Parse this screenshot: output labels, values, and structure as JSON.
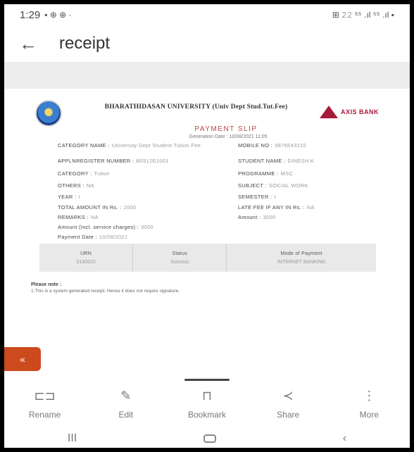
{
  "status_bar": {
    "time": "1:29",
    "indicators": "▪ ⊕ ⊕ ·",
    "system": "⊞ 𝟸𝟸 ⁵⁵ .ıl ⁵⁵ .ıl ▪"
  },
  "app_bar": {
    "title": "receipt"
  },
  "receipt": {
    "university": "BHARATHIDASAN UNIVERSITY (Univ Dept Stud.Tut.Fee)",
    "bank": "AXIS BANK",
    "slip_title": "PAYMENT SLIP",
    "generated": "Generation Date : 10/08/2021 11:05",
    "fields_left": [
      {
        "label": "CATEGORY NAME :",
        "value": "University Dept Student Tution Fee"
      },
      {
        "label": "APPLNREGISTER NUMBER :",
        "value": "B0512E1001"
      },
      {
        "label": "CATEGORY :",
        "value": "Tution"
      },
      {
        "label": "OTHERS :",
        "value": "NA"
      },
      {
        "label": "YEAR :",
        "value": "I"
      },
      {
        "label": "TOTAL AMOUNT IN Rs. :",
        "value": "2000"
      },
      {
        "label": "REMARKS :",
        "value": "NA"
      },
      {
        "label": "Amount (Incl. service charges) :",
        "value": "3000"
      },
      {
        "label": "Payment Date :",
        "value": "10/08/2021"
      }
    ],
    "fields_right": [
      {
        "label": "MOBILE NO :",
        "value": "9876543210"
      },
      {
        "label": "STUDENT NAME :",
        "value": "DINESH K"
      },
      {
        "label": "PROGRAMME :",
        "value": "MSC"
      },
      {
        "label": "SUBJECT :",
        "value": "SOCIAL WORK"
      },
      {
        "label": "SEMESTER :",
        "value": "I"
      },
      {
        "label": "LATE FEE IF ANY IN Rs. :",
        "value": "NA"
      },
      {
        "label": "Amount :",
        "value": "3000"
      }
    ],
    "table": {
      "headers": [
        "URN",
        "Status",
        "Mode of Payment"
      ],
      "cells": [
        "0140520",
        "Success",
        "INTERNET BANKING"
      ]
    },
    "note_title": "Please note :",
    "note_text": "1.This is a system generated receipt. Hence it does not require signature."
  },
  "fab": {
    "icon": "«"
  },
  "toolbar": {
    "items": [
      {
        "label": "Rename",
        "icon": "⊏⊐"
      },
      {
        "label": "Edit",
        "icon": "✎"
      },
      {
        "label": "Bookmark",
        "icon": "⊓"
      },
      {
        "label": "Share",
        "icon": "≺"
      },
      {
        "label": "More",
        "icon": "⋮"
      }
    ]
  },
  "nav": {
    "recents": "III",
    "back": "‹"
  }
}
